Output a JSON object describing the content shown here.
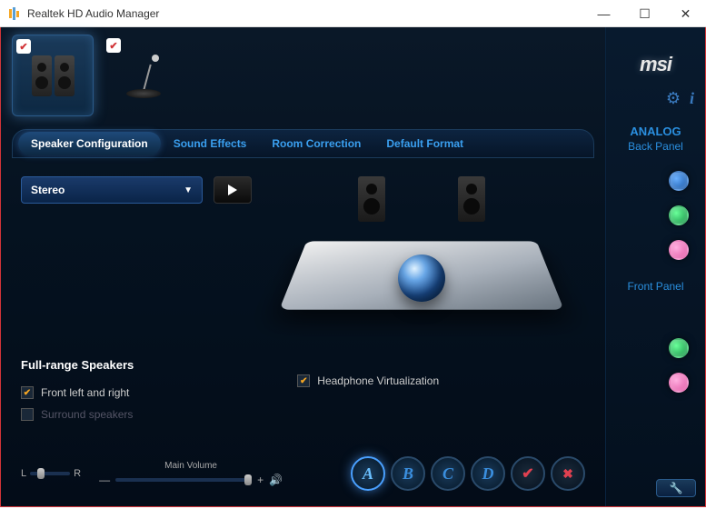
{
  "window": {
    "title": "Realtek HD Audio Manager"
  },
  "brand": "msi",
  "tabs": {
    "speaker_config": "Speaker Configuration",
    "sound_effects": "Sound Effects",
    "room_correction": "Room Correction",
    "default_format": "Default Format"
  },
  "config": {
    "dropdown_value": "Stereo"
  },
  "fullrange": {
    "title": "Full-range Speakers",
    "front_lr": "Front left and right",
    "surround": "Surround speakers"
  },
  "headphone_virt": "Headphone Virtualization",
  "volume": {
    "main_label": "Main Volume",
    "balance_left": "L",
    "balance_right": "R"
  },
  "presets": {
    "a": "A",
    "b": "B",
    "c": "C",
    "d": "D"
  },
  "side": {
    "analog": "ANALOG",
    "back_panel": "Back Panel",
    "front_panel": "Front Panel"
  }
}
